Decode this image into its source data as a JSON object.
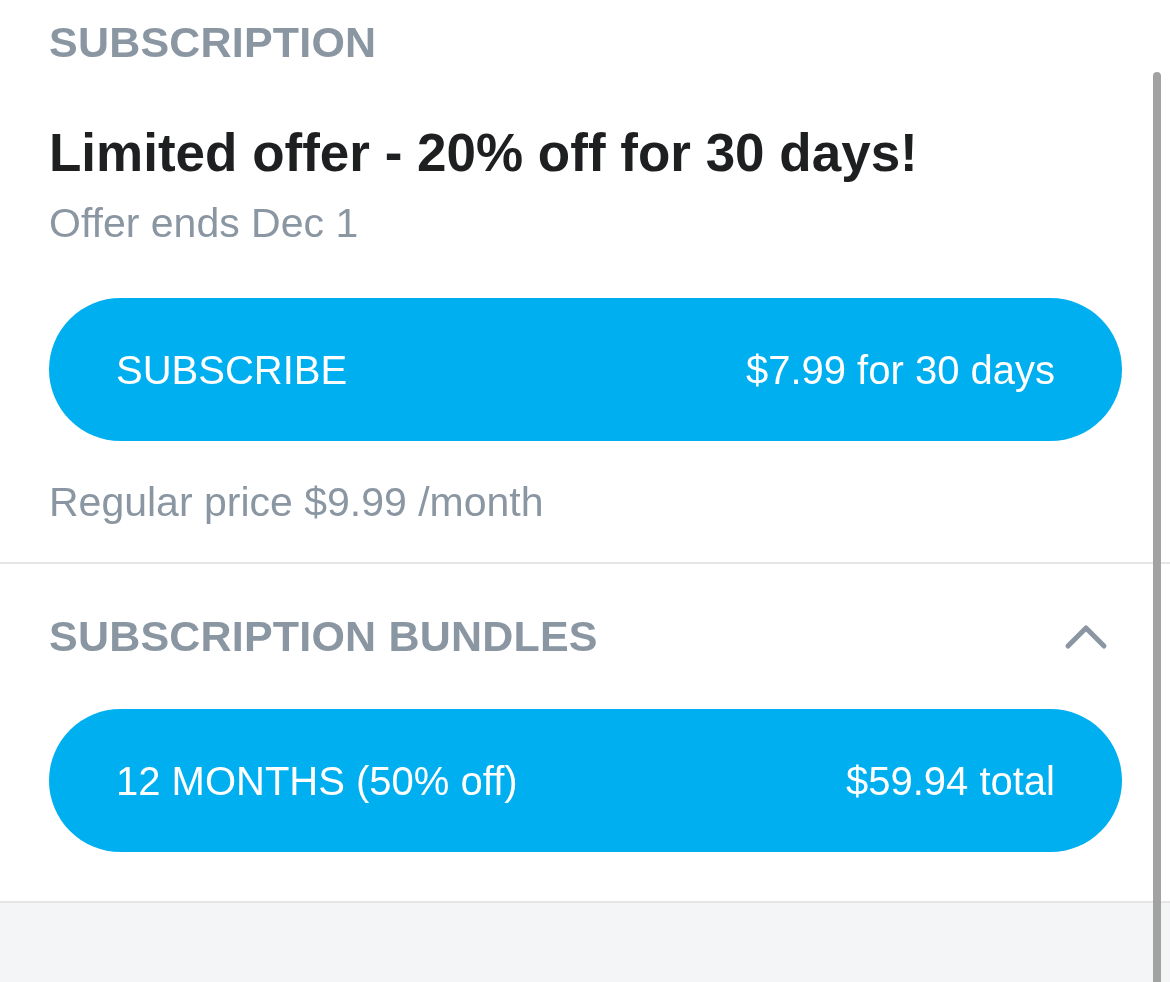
{
  "subscription": {
    "heading": "SUBSCRIPTION",
    "offer_title": "Limited offer - 20% off for 30 days!",
    "offer_note": "Offer ends Dec 1",
    "subscribe_button": {
      "label": "SUBSCRIBE",
      "price": "$7.99 for 30 days"
    },
    "regular_price": "Regular price $9.99 /month"
  },
  "bundles": {
    "heading": "SUBSCRIPTION BUNDLES",
    "expanded": true,
    "items": [
      {
        "label": "12 MONTHS (50% off)",
        "price": "$59.94 total"
      }
    ]
  }
}
